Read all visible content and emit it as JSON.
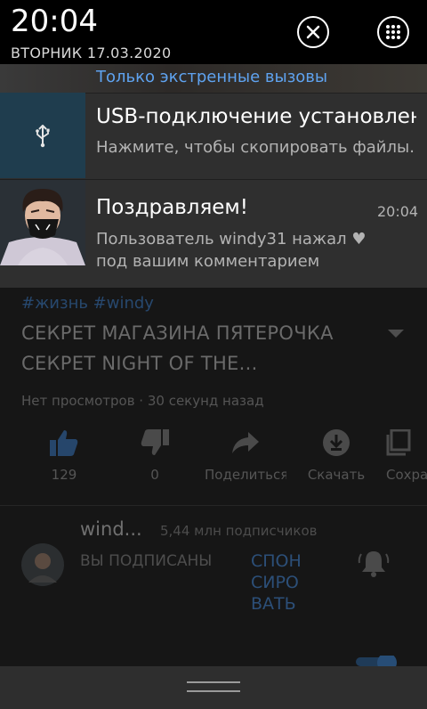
{
  "status": {
    "time": "20:04",
    "date": "ВТОРНИК 17.03.2020"
  },
  "quick_actions": [
    {
      "icon": "close-icon"
    },
    {
      "icon": "apps-grid-icon"
    }
  ],
  "emergency": {
    "text": "Только экстренные вызовы"
  },
  "notifications": [
    {
      "icon": "usb-icon",
      "title": "USB-подключение установлено",
      "text": "Нажмите, чтобы скопировать файлы."
    },
    {
      "title": "Поздравляем!",
      "time": "20:04",
      "text_line1": "Пользователь windy31 нажал ♥",
      "text_line2": "под вашим комментарием"
    }
  ],
  "video": {
    "hashtags": "#жизнь #windy",
    "title_line1": "СЕКРЕТ МАГАЗИНА ПЯТЕРОЧКА",
    "title_line2": "СЕКРЕТ NIGHT OF THE...",
    "meta": "Нет просмотров · 30 секунд назад",
    "actions": [
      {
        "icon": "thumbs-up-icon",
        "label": "129"
      },
      {
        "icon": "thumbs-down-icon",
        "label": "0"
      },
      {
        "icon": "share-icon",
        "label": "Поделиться"
      },
      {
        "icon": "download-icon",
        "label": "Скачать"
      },
      {
        "icon": "save-icon",
        "label": "Сохранить"
      }
    ]
  },
  "channel": {
    "name": "wind...",
    "subscribers": "5,44 млн подписчиков",
    "subscribed_label": "ВЫ ПОДПИСАНЫ",
    "sponsor_line1": "СПОН",
    "sponsor_line2": "СИРО",
    "sponsor_line3": "ВАТЬ"
  },
  "colors": {
    "link": "#5fa3f0",
    "usb_icon_bg": "#1f3d4e",
    "notification_bg": "#2f2f2f"
  }
}
